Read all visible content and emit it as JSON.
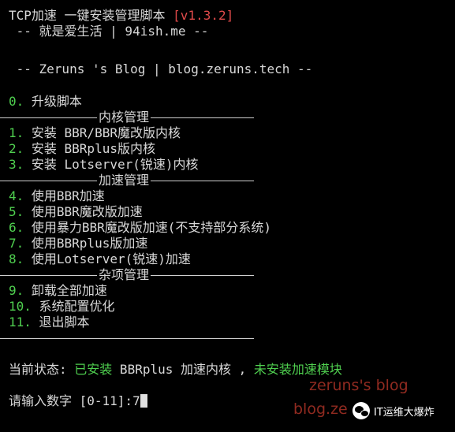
{
  "header": {
    "title": "TCP加速 一键安装管理脚本 ",
    "version": "[v1.3.2]",
    "subtitle": " -- 就是爱生活 | 94ish.me --",
    "blog_line": " -- Zeruns 's Blog | blog.zeruns.tech --"
  },
  "menu": {
    "upgrade": {
      "num": "0.",
      "label": " 升级脚本"
    },
    "sections": [
      {
        "title": "内核管理"
      },
      {
        "title": "加速管理"
      },
      {
        "title": "杂项管理"
      }
    ],
    "kernel_items": [
      {
        "num": "1.",
        "label": " 安装 BBR/BBR魔改版内核"
      },
      {
        "num": "2.",
        "label": " 安装 BBRplus版内核"
      },
      {
        "num": "3.",
        "label": " 安装 Lotserver(锐速)内核"
      }
    ],
    "accel_items": [
      {
        "num": "4.",
        "label": " 使用BBR加速"
      },
      {
        "num": "5.",
        "label": " 使用BBR魔改版加速"
      },
      {
        "num": "6.",
        "label": " 使用暴力BBR魔改版加速(不支持部分系统)"
      },
      {
        "num": "7.",
        "label": " 使用BBRplus版加速"
      },
      {
        "num": "8.",
        "label": " 使用Lotserver(锐速)加速"
      }
    ],
    "misc_items": [
      {
        "num": "9.",
        "label": " 卸载全部加速"
      },
      {
        "num": "10.",
        "label": " 系统配置优化"
      },
      {
        "num": "11.",
        "label": " 退出脚本"
      }
    ]
  },
  "status": {
    "prefix": "当前状态: ",
    "installed": "已安装",
    "kernel": " BBRplus 加速内核 , ",
    "not_installed": "未安装加速模块"
  },
  "prompt": {
    "text": "请输入数字 [0-11]:",
    "value": "7"
  },
  "watermark": {
    "line1": "zeruns's blog",
    "line2": "blog.ze",
    "badge": "IT运维大爆炸"
  },
  "colors": {
    "background": "#000000",
    "text": "#d8d8d8",
    "green": "#4fcf4f",
    "red": "#e04a4a"
  }
}
